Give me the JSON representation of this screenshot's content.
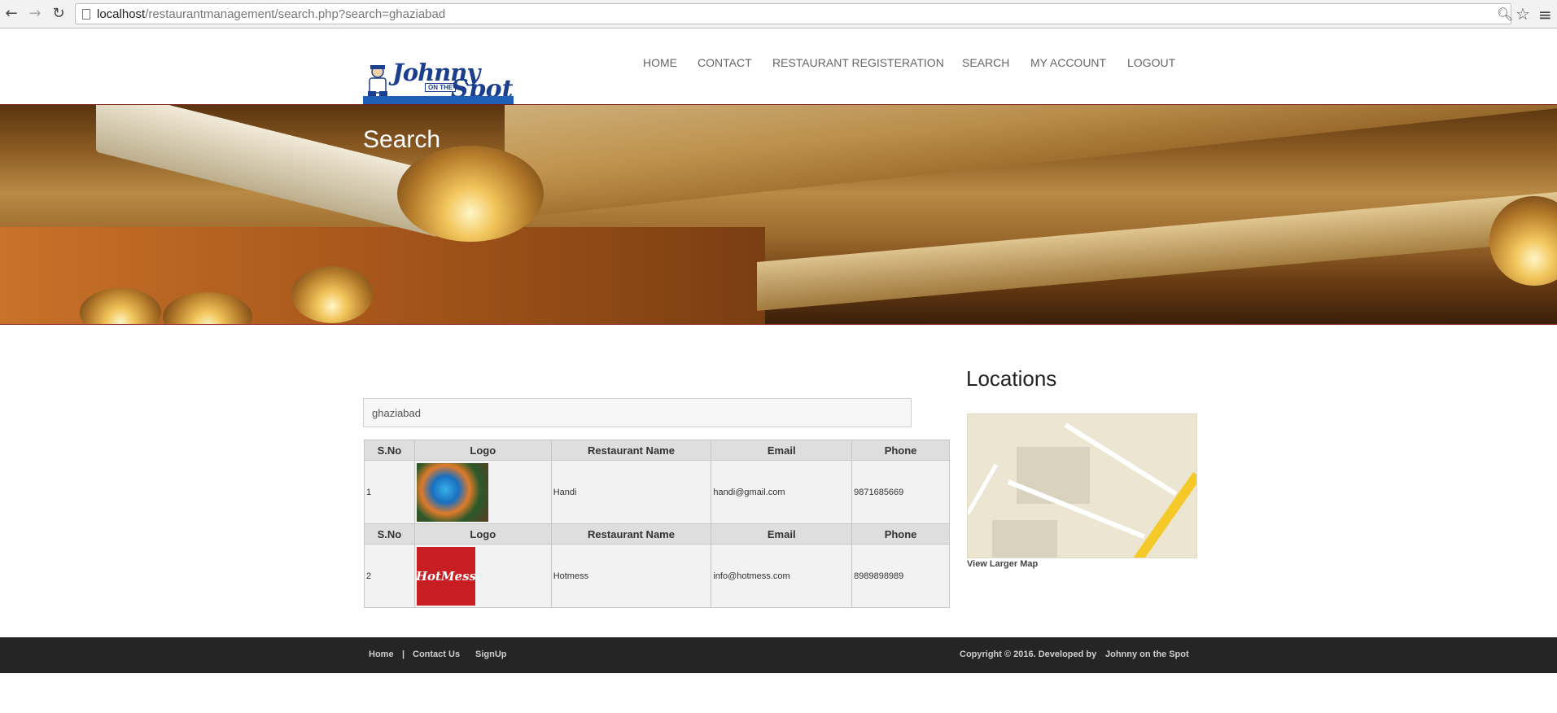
{
  "browser": {
    "url_host": "localhost",
    "url_path": "/restaurantmanagement/search.php?search=ghaziabad",
    "back_icon": "arrow-left-icon",
    "forward_icon": "arrow-right-icon",
    "reload_icon": "reload-icon"
  },
  "header": {
    "logo_word1": "Johnny",
    "logo_word2": "Spot",
    "logo_small": "ON THE",
    "nav": [
      "HOME",
      "CONTACT",
      "RESTAURANT REGISTERATION",
      "SEARCH",
      "MY ACCOUNT",
      "LOGOUT"
    ]
  },
  "banner": {
    "title": "Search"
  },
  "search": {
    "value": "ghaziabad"
  },
  "results": {
    "headers": [
      "S.No",
      "Logo",
      "Restaurant Name",
      "Email",
      "Phone"
    ],
    "rows": [
      {
        "sno": "1",
        "name": "Handi",
        "email": "handi@gmail.com",
        "phone": "9871685669"
      },
      {
        "sno": "2",
        "name": "Hotmess",
        "email": "info@hotmess.com",
        "phone": "8989898989",
        "logo_text": "HotMess"
      }
    ]
  },
  "sidebar": {
    "title": "Locations",
    "map_link": "View Larger Map"
  },
  "footer": {
    "links": [
      "Home",
      "|",
      "Contact Us",
      "SignUp"
    ],
    "copyright": "Copyright © 2016. Developed by",
    "developer": "Johnny on the Spot"
  }
}
